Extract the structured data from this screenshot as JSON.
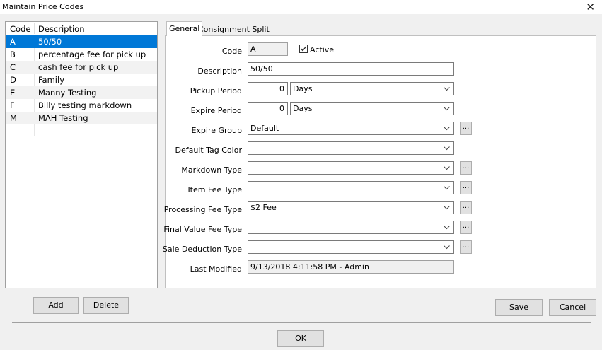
{
  "window": {
    "title": "Maintain Price Codes",
    "close_glyph": "✕"
  },
  "list": {
    "headers": {
      "code": "Code",
      "description": "Description"
    },
    "rows": [
      {
        "code": "A",
        "description": "50/50"
      },
      {
        "code": "B",
        "description": "percentage fee for pick up"
      },
      {
        "code": "C",
        "description": "cash fee for pick up"
      },
      {
        "code": "D",
        "description": "Family"
      },
      {
        "code": "E",
        "description": "Manny Testing"
      },
      {
        "code": "F",
        "description": "Billy testing markdown"
      },
      {
        "code": "M",
        "description": "MAH Testing"
      }
    ],
    "selected_index": 0
  },
  "tabs": {
    "general": "General",
    "consignment": "Consignment Split"
  },
  "form": {
    "code": {
      "label": "Code",
      "value": "A"
    },
    "active": {
      "label": "Active",
      "checked": true
    },
    "description": {
      "label": "Description",
      "value": "50/50"
    },
    "pickup_period": {
      "label": "Pickup Period",
      "value": "0",
      "unit": "Days"
    },
    "expire_period": {
      "label": "Expire Period",
      "value": "0",
      "unit": "Days"
    },
    "expire_group": {
      "label": "Expire Group",
      "value": "Default"
    },
    "default_tag_color": {
      "label": "Default Tag Color",
      "value": ""
    },
    "markdown_type": {
      "label": "Markdown Type",
      "value": ""
    },
    "item_fee_type": {
      "label": "Item Fee Type",
      "value": ""
    },
    "processing_fee_type": {
      "label": "Processing Fee Type",
      "value": "$2 Fee"
    },
    "final_value_fee_type": {
      "label": "Final Value Fee Type",
      "value": ""
    },
    "sale_deduction_type": {
      "label": "Sale Deduction Type",
      "value": ""
    },
    "last_modified": {
      "label": "Last Modified",
      "value": "9/13/2018 4:11:58 PM - Admin"
    },
    "ellipsis": "..."
  },
  "buttons": {
    "add": "Add",
    "delete": "Delete",
    "save": "Save",
    "cancel": "Cancel",
    "ok": "OK"
  },
  "colors": {
    "selection": "#0078d7",
    "window_bg": "#f0f0f0"
  }
}
